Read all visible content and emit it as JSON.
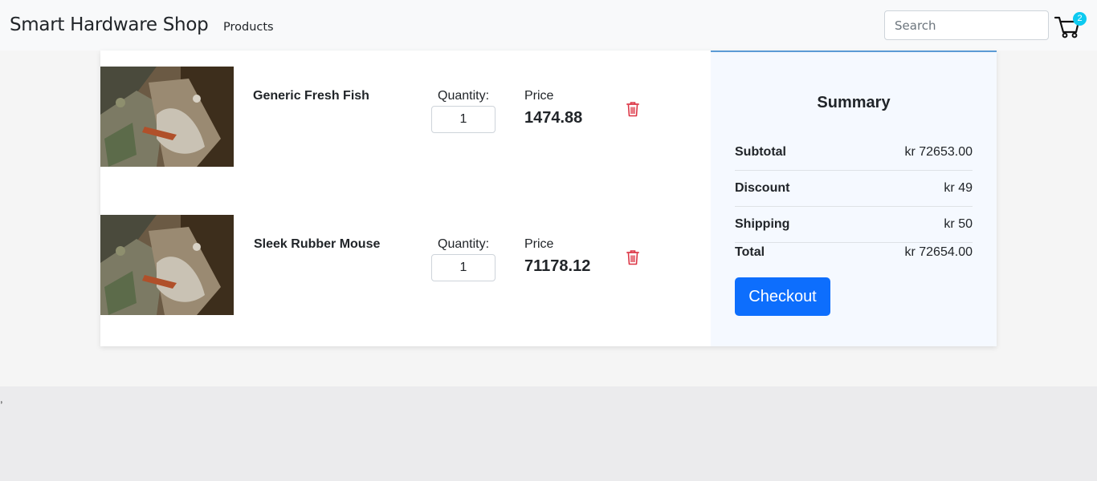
{
  "navbar": {
    "brand": "Smart Hardware Shop",
    "products_link": "Products",
    "search_placeholder": "Search",
    "cart_count": "2"
  },
  "cart_items": [
    {
      "name": "Generic Fresh Fish",
      "quantity_label": "Quantity:",
      "quantity": "1",
      "price_label": "Price",
      "price": "1474.88"
    },
    {
      "name": "Sleek Rubber Mouse",
      "quantity_label": "Quantity:",
      "quantity": "1",
      "price_label": "Price",
      "price": "71178.12"
    }
  ],
  "summary": {
    "title": "Summary",
    "subtotal_label": "Subtotal",
    "subtotal": "kr 72653.00",
    "discount_label": "Discount",
    "discount": "kr 49",
    "shipping_label": "Shipping",
    "shipping": "kr 50",
    "total_label": "Total",
    "total": "kr 72654.00",
    "checkout_label": "Checkout"
  },
  "footer_text": ",",
  "colors": {
    "accent": "#0d6efd",
    "badge": "#0dcaf0",
    "delete": "#dc3545",
    "summary_bg": "#f5f9ff"
  }
}
